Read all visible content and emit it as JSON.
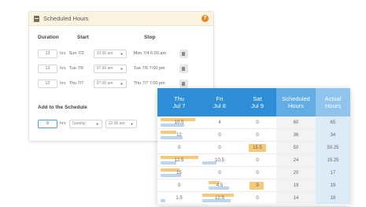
{
  "panel": {
    "title": "Scheduled Hours",
    "help": "?",
    "columns": {
      "duration": "Duration",
      "start": "Start",
      "stop": "Stop"
    },
    "rows": [
      {
        "duration": "12",
        "unit": "hrs",
        "start_date": "Sun 7/3",
        "start_time": "10:00 am",
        "stop": "Mon 7/4 6:00 am"
      },
      {
        "duration": "12",
        "unit": "hrs",
        "start_date": "Tue 7/5",
        "start_time": "07:00 am",
        "stop": "Tue 7/5 7:00 pm"
      },
      {
        "duration": "12",
        "unit": "hrs",
        "start_date": "Thu 7/7",
        "start_time": "07:00 am",
        "stop": "Thu 7/7 7:00 pm"
      }
    ],
    "add_label": "Add to the Schedule",
    "add": {
      "duration": "8",
      "unit": "hrs",
      "day": "Sunday",
      "time": "12:00 am"
    }
  },
  "table": {
    "headers": [
      {
        "line1": "Thu",
        "line2": "Jul 7"
      },
      {
        "line1": "Fri",
        "line2": "Jul 8"
      },
      {
        "line1": "Sat",
        "line2": "Jul 9"
      },
      {
        "line1": "Scheduled",
        "line2": "Hours"
      },
      {
        "line1": "Actual",
        "line2": "Hours"
      }
    ],
    "rows": [
      [
        "10.5",
        "4",
        "0",
        "60",
        "65"
      ],
      [
        "12",
        "0",
        "0",
        "36",
        "34"
      ],
      [
        "0",
        "0",
        "15.5",
        "50",
        "50.25"
      ],
      [
        "12.5",
        "10.5",
        "0",
        "24",
        "15.25"
      ],
      [
        "15",
        "0",
        "0",
        "20",
        "17"
      ],
      [
        "0",
        "4.5",
        "9",
        "19",
        "19"
      ],
      [
        "1.5",
        "12.5",
        "0",
        "14",
        "18"
      ]
    ]
  },
  "colors": {
    "header_day": "#2e8fd8",
    "header_scheduled": "#62ade6",
    "header_actual": "#8ec4ee",
    "highlight_orange": "#f7c97a",
    "highlight_blue": "#bcd6f2",
    "panel_header": "#fbf3df",
    "help_icon": "#e8861c"
  }
}
